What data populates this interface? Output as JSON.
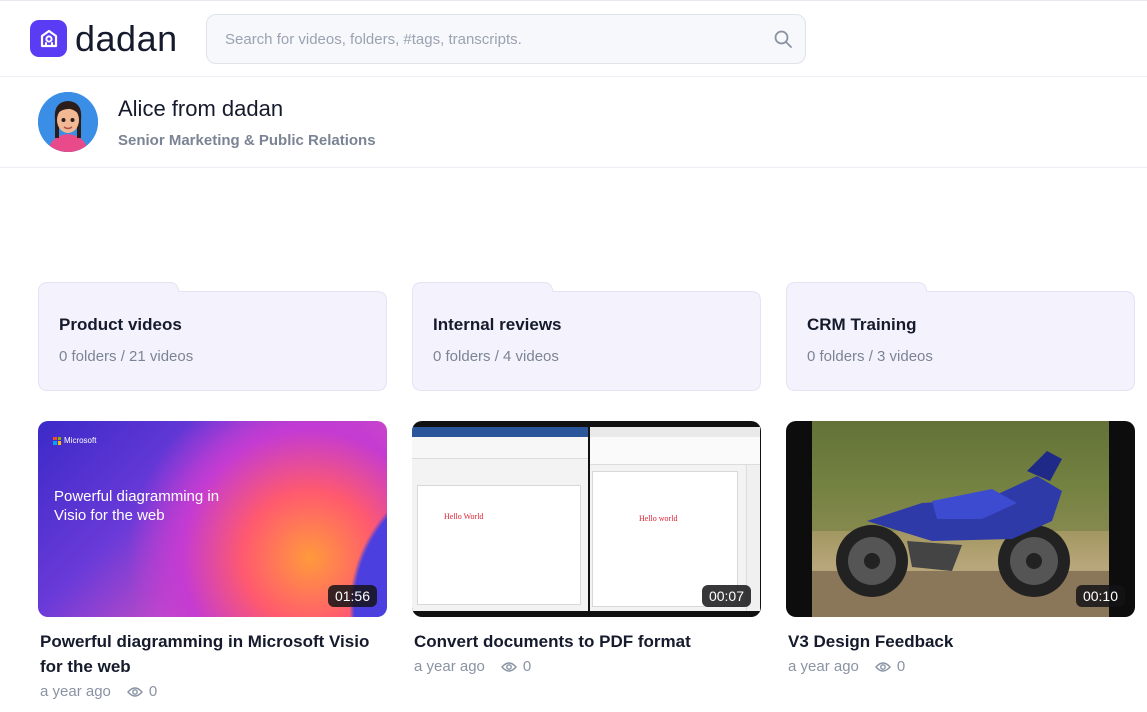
{
  "header": {
    "logo_text": "dadan",
    "search_placeholder": "Search for videos, folders, #tags, transcripts."
  },
  "profile": {
    "name": "Alice from dadan",
    "role": "Senior Marketing & Public Relations"
  },
  "folders": [
    {
      "name": "Product videos",
      "meta": "0 folders / 21 videos"
    },
    {
      "name": "Internal reviews",
      "meta": "0 folders / 4 videos"
    },
    {
      "name": "CRM Training",
      "meta": "0 folders / 3 videos"
    }
  ],
  "videos": [
    {
      "title": "Powerful diagramming in Microsoft Visio for the web",
      "duration": "01:56",
      "age": "a year ago",
      "views": "0",
      "thumb_brand": "Microsoft",
      "thumb_caption": "Powerful diagramming in Visio for the web"
    },
    {
      "title": "Convert documents to PDF format",
      "duration": "00:07",
      "age": "a year ago",
      "views": "0",
      "thumb_text_left": "Hello World",
      "thumb_text_right": "Hello world"
    },
    {
      "title": "V3 Design Feedback",
      "duration": "00:10",
      "age": "a year ago",
      "views": "0"
    }
  ],
  "colors": {
    "brand": "#5b3cf5",
    "folder_bg": "#f4f3fd",
    "folder_border": "#e4e2f3"
  },
  "icons": [
    "logo-icon",
    "search-icon",
    "eye-icon",
    "folder-icon"
  ]
}
